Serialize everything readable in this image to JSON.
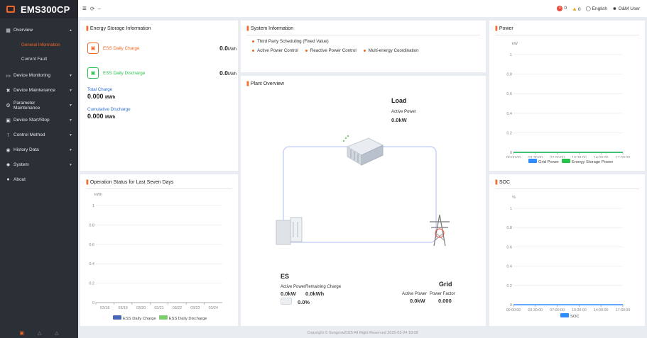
{
  "app": {
    "title": "EMS300CP"
  },
  "sidebar": {
    "items": [
      {
        "label": "Overview",
        "icon": "dashboard-icon"
      },
      {
        "label": "Device Monitoring",
        "icon": "monitor-icon"
      },
      {
        "label": "Device Maintenance",
        "icon": "wrench-icon"
      },
      {
        "label": "Parameter Maintenance",
        "icon": "sliders-icon"
      },
      {
        "label": "Device Start/Stop",
        "icon": "power-icon"
      },
      {
        "label": "Control Method",
        "icon": "control-icon"
      },
      {
        "label": "History Data",
        "icon": "history-icon"
      },
      {
        "label": "System",
        "icon": "gear-icon"
      },
      {
        "label": "About",
        "icon": "info-icon"
      }
    ],
    "subitems": [
      "General Information",
      "Current Fault"
    ]
  },
  "topbar": {
    "fault_count": "0",
    "warning_count": "0",
    "language": "English",
    "user": "O&M User"
  },
  "energy": {
    "title": "Energy Storage Information",
    "daily_charge_label": "ESS Daily Charge",
    "daily_charge_value": "0.0",
    "daily_discharge_label": "ESS Daily Discharge",
    "daily_discharge_value": "0.0",
    "unit_kwh": "kWh",
    "total_charge_label": "Total Charge",
    "total_charge_value": "0.000",
    "cum_discharge_label": "Cumulative Discharge",
    "cum_discharge_value": "0.000",
    "unit_mwh": "MWh"
  },
  "system_info": {
    "title": "System Information",
    "line1": "Third Party Scheduling (Fixed Value)",
    "line2": [
      "Active Power Control",
      "Reactive Power Control",
      "Multi-energy Coordination"
    ]
  },
  "plant": {
    "title": "Plant Overview",
    "load_title": "Load",
    "load_ap_label": "Active Power",
    "load_ap_value": "0.0kW",
    "es_title": "ES",
    "es_ap_label": "Active Power",
    "es_rc_label": "Remaining Charge",
    "es_ap_value": "0.0kW",
    "es_rc_value": "0.0kWh",
    "es_soc": "0.0%",
    "grid_title": "Grid",
    "grid_ap_label": "Active Power",
    "grid_pf_label": "Power Factor",
    "grid_ap_value": "0.0kW",
    "grid_pf_value": "0.000"
  },
  "op_status": {
    "title": "Operation Status for Last Seven Days"
  },
  "power": {
    "title": "Power"
  },
  "soc": {
    "title": "SOC"
  },
  "footer": {
    "text": "Copyright © Sungrow2025 All Right Reserved    2025-03-24 18:08"
  },
  "colors": {
    "accent": "#f26522",
    "grid_power": "#2f8cff",
    "energy_storage": "#27c24c",
    "ess_charge": "#4867b8",
    "ess_discharge": "#7dcc6e"
  },
  "chart_data": [
    {
      "type": "bar",
      "title": "Operation Status for Last Seven Days",
      "ylabel": "kWh",
      "categories": [
        "03/18",
        "03/19",
        "03/20",
        "03/21",
        "03/22",
        "03/23",
        "03/24"
      ],
      "ylim": [
        0,
        1
      ],
      "yticks": [
        "0",
        "0.2",
        "0.4",
        "0.6",
        "0.8",
        "1"
      ],
      "series": [
        {
          "name": "ESS Daily Charge",
          "values": [
            0,
            0,
            0,
            0,
            0,
            0,
            0
          ]
        },
        {
          "name": "ESS Daily Discharge",
          "values": [
            0,
            0,
            0,
            0,
            0,
            0,
            0
          ]
        }
      ]
    },
    {
      "type": "line",
      "title": "Power",
      "ylabel": "kW",
      "x": [
        "00:00:00",
        "03:30:00",
        "07:00:00",
        "10:30:00",
        "14:00:00",
        "17:30:00"
      ],
      "ylim": [
        0,
        1
      ],
      "yticks": [
        "0",
        "0.2",
        "0.4",
        "0.6",
        "0.8",
        "1"
      ],
      "series": [
        {
          "name": "Grid Power",
          "values": [
            0,
            0,
            0,
            0,
            0,
            0
          ]
        },
        {
          "name": "Energy Storage Power",
          "values": [
            0,
            0,
            0,
            0,
            0,
            0
          ]
        }
      ]
    },
    {
      "type": "line",
      "title": "SOC",
      "ylabel": "%",
      "x": [
        "00:00:00",
        "03:30:00",
        "07:00:00",
        "10:30:00",
        "14:00:00",
        "17:30:00"
      ],
      "ylim": [
        0,
        1
      ],
      "yticks": [
        "0",
        "0.2",
        "0.4",
        "0.6",
        "0.8",
        "1"
      ],
      "series": [
        {
          "name": "SOC",
          "values": [
            0,
            0,
            0,
            0,
            0,
            0
          ]
        }
      ]
    }
  ]
}
